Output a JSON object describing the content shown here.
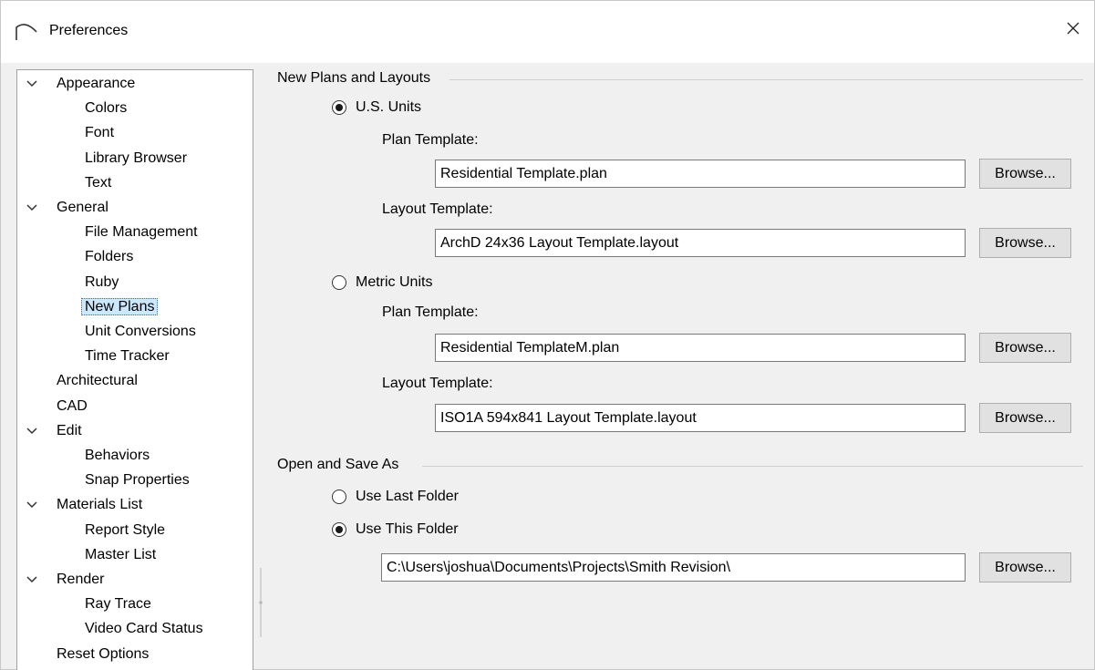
{
  "window": {
    "title": "Preferences",
    "app_icon": "arc-logo-icon",
    "close_icon": "close-icon",
    "close_glyph": "✕"
  },
  "tree": {
    "items": [
      {
        "label": "Appearance",
        "level": 0,
        "expanded": true
      },
      {
        "label": "Colors",
        "level": 1
      },
      {
        "label": "Font",
        "level": 1
      },
      {
        "label": "Library Browser",
        "level": 1
      },
      {
        "label": "Text",
        "level": 1
      },
      {
        "label": "General",
        "level": 0,
        "expanded": true
      },
      {
        "label": "File Management",
        "level": 1
      },
      {
        "label": "Folders",
        "level": 1
      },
      {
        "label": "Ruby",
        "level": 1
      },
      {
        "label": "New Plans",
        "level": 1,
        "selected": true
      },
      {
        "label": "Unit Conversions",
        "level": 1
      },
      {
        "label": "Time Tracker",
        "level": 1
      },
      {
        "label": "Architectural",
        "level": 0
      },
      {
        "label": "CAD",
        "level": 0
      },
      {
        "label": "Edit",
        "level": 0,
        "expanded": true
      },
      {
        "label": "Behaviors",
        "level": 1
      },
      {
        "label": "Snap Properties",
        "level": 1
      },
      {
        "label": "Materials List",
        "level": 0,
        "expanded": true
      },
      {
        "label": "Report Style",
        "level": 1
      },
      {
        "label": "Master List",
        "level": 1
      },
      {
        "label": "Render",
        "level": 0,
        "expanded": true
      },
      {
        "label": "Ray Trace",
        "level": 1
      },
      {
        "label": "Video Card Status",
        "level": 1
      },
      {
        "label": "Reset Options",
        "level": 0
      }
    ]
  },
  "new_plans": {
    "group_title": "New Plans and Layouts",
    "us_units": {
      "label": "U.S. Units",
      "checked": true,
      "plan_template_label": "Plan Template:",
      "plan_template_value": "Residential Template.plan",
      "layout_template_label": "Layout Template:",
      "layout_template_value": "ArchD 24x36 Layout Template.layout"
    },
    "metric_units": {
      "label": "Metric Units",
      "checked": false,
      "plan_template_label": "Plan Template:",
      "plan_template_value": "Residential TemplateM.plan",
      "layout_template_label": "Layout Template:",
      "layout_template_value": "ISO1A 594x841 Layout Template.layout"
    },
    "browse_label": "Browse..."
  },
  "open_save": {
    "group_title": "Open and Save As",
    "use_last_folder": {
      "label": "Use Last Folder",
      "checked": false
    },
    "use_this_folder": {
      "label": "Use This Folder",
      "checked": true
    },
    "folder_path": "C:\\Users\\joshua\\Documents\\Projects\\Smith Revision\\",
    "browse_label": "Browse..."
  }
}
